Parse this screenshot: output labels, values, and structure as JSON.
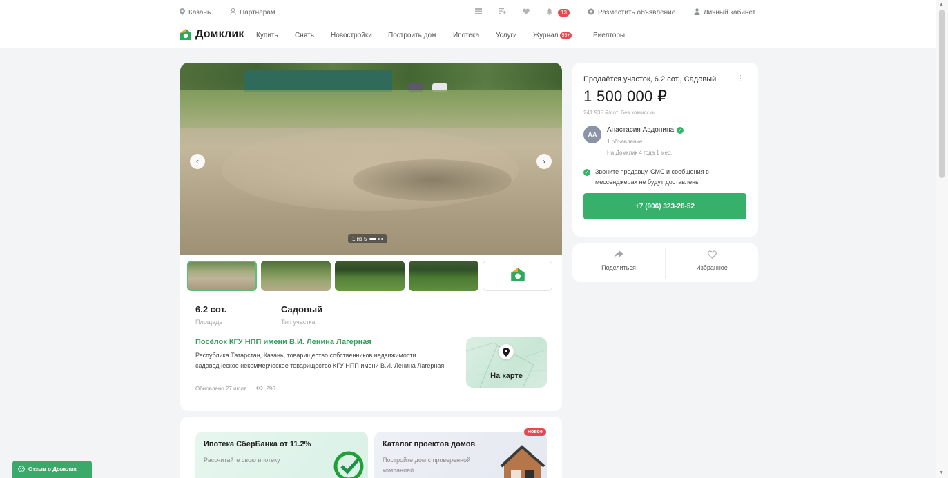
{
  "topbar": {
    "city": "Казань",
    "partners": "Партнерам",
    "notifications_count": "13",
    "post_ad": "Разместить объявление",
    "account": "Личный кабинет"
  },
  "nav": {
    "brand": "Домклик",
    "items": [
      "Купить",
      "Снять",
      "Новостройки",
      "Построить дом",
      "Ипотека",
      "Услуги",
      "Журнал",
      "Риелторы"
    ],
    "journal_badge": "99+"
  },
  "gallery": {
    "counter": "1 из 5",
    "current": 1,
    "total": 5
  },
  "specs": [
    {
      "value": "6.2 сот.",
      "label": "Площадь"
    },
    {
      "value": "Садовый",
      "label": "Тип участка"
    }
  ],
  "address": {
    "title": "Посёлок КГУ НПП имени В.И. Ленина Лагерная",
    "full": "Республика Татарстан, Казань, товарищество собственников недвижимости садоводческое некоммерческое товарищество КГУ НПП имени В.И. Ленина Лагерная",
    "updated": "Обновлено 27 июля",
    "views": "296",
    "map_label": "На карте"
  },
  "promos": [
    {
      "title": "Ипотека СберБанка от 11.2%",
      "subtitle": "Рассчитайте свою ипотеку"
    },
    {
      "title": "Каталог проектов домов",
      "subtitle": "Постройте дом с проверенной компанией",
      "badge": "Новое"
    }
  ],
  "listing": {
    "title": "Продаётся участок, 6.2 сот., Садовый",
    "price": "1 500 000 ₽",
    "price_per_unit": "241 935 ₽/сот.   Без комиссии",
    "seller": {
      "initials": "АА",
      "name": "Анастасия Авдонина",
      "ads": "1 объявление",
      "since": "На Домклик 4 года 1 мес."
    },
    "notice": "Звоните продавцу, СМС и сообщения в мессенджерах не будут доставлены",
    "phone": "+7 (906) 323-26-52"
  },
  "actions": {
    "share": "Поделиться",
    "favorite": "Избранное"
  },
  "feedback": "Отзыв о Домклик",
  "colors": {
    "brand_green": "#37b06b",
    "link_green": "#2ea35a",
    "badge_red": "#e5484d"
  }
}
